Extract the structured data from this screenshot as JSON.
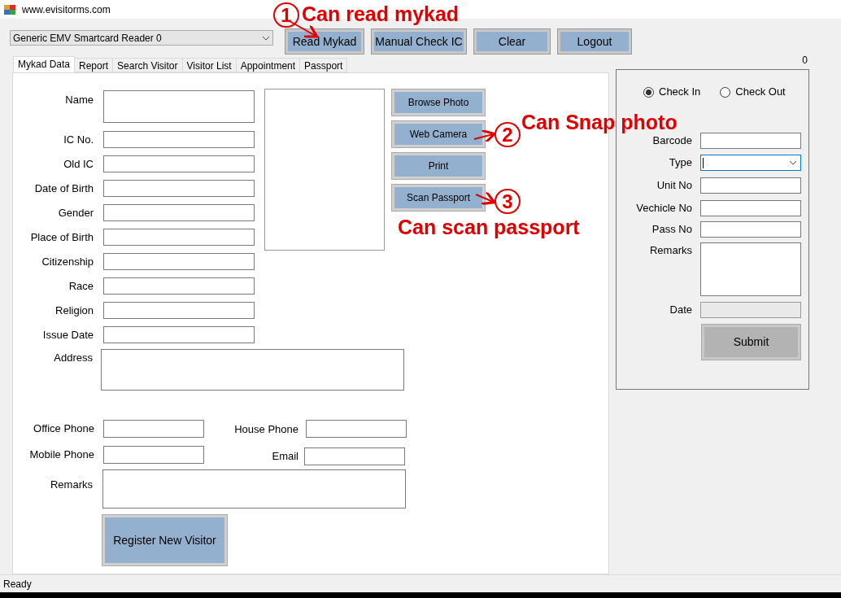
{
  "window": {
    "title": "www.evisitorms.com"
  },
  "toolbar": {
    "reader_select": {
      "value": "Generic EMV Smartcard Reader 0"
    },
    "buttons": [
      "Read Mykad",
      "Manual Check IC",
      "Clear",
      "Logout"
    ],
    "counter": "0"
  },
  "tabs": [
    {
      "label": "Mykad Data",
      "selected": true
    },
    {
      "label": "Report",
      "selected": false
    },
    {
      "label": "Search Visitor",
      "selected": false
    },
    {
      "label": "Visitor List",
      "selected": false
    },
    {
      "label": "Appointment",
      "selected": false
    },
    {
      "label": "Passport",
      "selected": false
    }
  ],
  "mykad_form": {
    "fields": [
      {
        "label": "Name",
        "kind": "tall"
      },
      {
        "label": "IC No.",
        "kind": "text"
      },
      {
        "label": "Old IC",
        "kind": "text"
      },
      {
        "label": "Date of Birth",
        "kind": "text"
      },
      {
        "label": "Gender",
        "kind": "text"
      },
      {
        "label": "Place of Birth",
        "kind": "text"
      },
      {
        "label": "Citizenship",
        "kind": "text"
      },
      {
        "label": "Race",
        "kind": "text"
      },
      {
        "label": "Religion",
        "kind": "text"
      },
      {
        "label": "Issue Date",
        "kind": "text"
      }
    ],
    "photo_buttons": [
      "Browse Photo",
      "Web Camera",
      "Print",
      "Scan Passport"
    ],
    "address": {
      "label": "Address"
    },
    "contact_rows": [
      [
        {
          "label": "Office Phone"
        },
        {
          "label": "House Phone"
        }
      ],
      [
        {
          "label": "Mobile Phone"
        },
        {
          "label": "Email"
        }
      ]
    ],
    "remarks": {
      "label": "Remarks"
    },
    "register_button": "Register New Visitor"
  },
  "check_panel": {
    "radios": [
      {
        "label": "Check In",
        "selected": true
      },
      {
        "label": "Check Out",
        "selected": false
      }
    ],
    "fields": [
      {
        "label": "Barcode",
        "kind": "text",
        "focused": false,
        "disabled": false
      },
      {
        "label": "Type",
        "kind": "select",
        "focused": true,
        "disabled": false
      },
      {
        "label": "Unit No",
        "kind": "text",
        "focused": false,
        "disabled": false
      },
      {
        "label": "Vechicle No",
        "kind": "text",
        "focused": false,
        "disabled": false
      },
      {
        "label": "Pass No",
        "kind": "text",
        "focused": false,
        "disabled": false
      },
      {
        "label": "Remarks",
        "kind": "multiline",
        "focused": false,
        "disabled": false
      },
      {
        "label": "Date",
        "kind": "text",
        "focused": false,
        "disabled": true
      }
    ],
    "submit_button": "Submit"
  },
  "annotations": [
    {
      "number": "1",
      "text": "Can read mykad"
    },
    {
      "number": "2",
      "text": "Can Snap photo"
    },
    {
      "number": "3",
      "text": "Can scan passport"
    }
  ],
  "status_bar": {
    "text": "Ready"
  }
}
